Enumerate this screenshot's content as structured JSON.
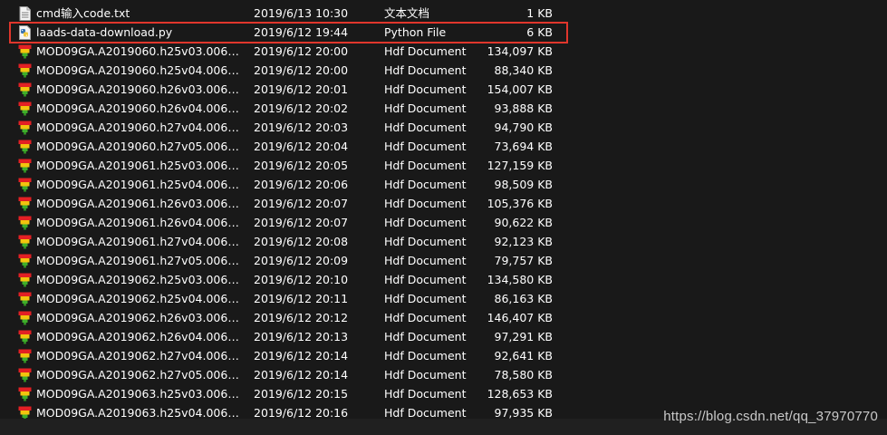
{
  "files": [
    {
      "icon": "text-file-icon",
      "name": "cmd输入code.txt",
      "modified": "2019/6/13 10:30",
      "type": "文本文档",
      "size": "1 KB"
    },
    {
      "icon": "python-file-icon",
      "name": "laads-data-download.py",
      "modified": "2019/6/12 19:44",
      "type": "Python File",
      "size": "6 KB"
    },
    {
      "icon": "hdf-file-icon",
      "name": "MOD09GA.A2019060.h25v03.006.201...",
      "modified": "2019/6/12 20:00",
      "type": "Hdf Document",
      "size": "134,097 KB"
    },
    {
      "icon": "hdf-file-icon",
      "name": "MOD09GA.A2019060.h25v04.006.201...",
      "modified": "2019/6/12 20:00",
      "type": "Hdf Document",
      "size": "88,340 KB"
    },
    {
      "icon": "hdf-file-icon",
      "name": "MOD09GA.A2019060.h26v03.006.201...",
      "modified": "2019/6/12 20:01",
      "type": "Hdf Document",
      "size": "154,007 KB"
    },
    {
      "icon": "hdf-file-icon",
      "name": "MOD09GA.A2019060.h26v04.006.201...",
      "modified": "2019/6/12 20:02",
      "type": "Hdf Document",
      "size": "93,888 KB"
    },
    {
      "icon": "hdf-file-icon",
      "name": "MOD09GA.A2019060.h27v04.006.201...",
      "modified": "2019/6/12 20:03",
      "type": "Hdf Document",
      "size": "94,790 KB"
    },
    {
      "icon": "hdf-file-icon",
      "name": "MOD09GA.A2019060.h27v05.006.201...",
      "modified": "2019/6/12 20:04",
      "type": "Hdf Document",
      "size": "73,694 KB"
    },
    {
      "icon": "hdf-file-icon",
      "name": "MOD09GA.A2019061.h25v03.006.201...",
      "modified": "2019/6/12 20:05",
      "type": "Hdf Document",
      "size": "127,159 KB"
    },
    {
      "icon": "hdf-file-icon",
      "name": "MOD09GA.A2019061.h25v04.006.201...",
      "modified": "2019/6/12 20:06",
      "type": "Hdf Document",
      "size": "98,509 KB"
    },
    {
      "icon": "hdf-file-icon",
      "name": "MOD09GA.A2019061.h26v03.006.201...",
      "modified": "2019/6/12 20:07",
      "type": "Hdf Document",
      "size": "105,376 KB"
    },
    {
      "icon": "hdf-file-icon",
      "name": "MOD09GA.A2019061.h26v04.006.201...",
      "modified": "2019/6/12 20:07",
      "type": "Hdf Document",
      "size": "90,622 KB"
    },
    {
      "icon": "hdf-file-icon",
      "name": "MOD09GA.A2019061.h27v04.006.201...",
      "modified": "2019/6/12 20:08",
      "type": "Hdf Document",
      "size": "92,123 KB"
    },
    {
      "icon": "hdf-file-icon",
      "name": "MOD09GA.A2019061.h27v05.006.201...",
      "modified": "2019/6/12 20:09",
      "type": "Hdf Document",
      "size": "79,757 KB"
    },
    {
      "icon": "hdf-file-icon",
      "name": "MOD09GA.A2019062.h25v03.006.201...",
      "modified": "2019/6/12 20:10",
      "type": "Hdf Document",
      "size": "134,580 KB"
    },
    {
      "icon": "hdf-file-icon",
      "name": "MOD09GA.A2019062.h25v04.006.201...",
      "modified": "2019/6/12 20:11",
      "type": "Hdf Document",
      "size": "86,163 KB"
    },
    {
      "icon": "hdf-file-icon",
      "name": "MOD09GA.A2019062.h26v03.006.201...",
      "modified": "2019/6/12 20:12",
      "type": "Hdf Document",
      "size": "146,407 KB"
    },
    {
      "icon": "hdf-file-icon",
      "name": "MOD09GA.A2019062.h26v04.006.201...",
      "modified": "2019/6/12 20:13",
      "type": "Hdf Document",
      "size": "97,291 KB"
    },
    {
      "icon": "hdf-file-icon",
      "name": "MOD09GA.A2019062.h27v04.006.201...",
      "modified": "2019/6/12 20:14",
      "type": "Hdf Document",
      "size": "92,641 KB"
    },
    {
      "icon": "hdf-file-icon",
      "name": "MOD09GA.A2019062.h27v05.006.201...",
      "modified": "2019/6/12 20:14",
      "type": "Hdf Document",
      "size": "78,580 KB"
    },
    {
      "icon": "hdf-file-icon",
      "name": "MOD09GA.A2019063.h25v03.006.201...",
      "modified": "2019/6/12 20:15",
      "type": "Hdf Document",
      "size": "128,653 KB"
    },
    {
      "icon": "hdf-file-icon",
      "name": "MOD09GA.A2019063.h25v04.006.201...",
      "modified": "2019/6/12 20:16",
      "type": "Hdf Document",
      "size": "97,935 KB"
    }
  ],
  "highlighted_file": "laads-data-download.py",
  "highlight_color": "#e0362c",
  "watermark": "https://blog.csdn.net/qq_37970770"
}
